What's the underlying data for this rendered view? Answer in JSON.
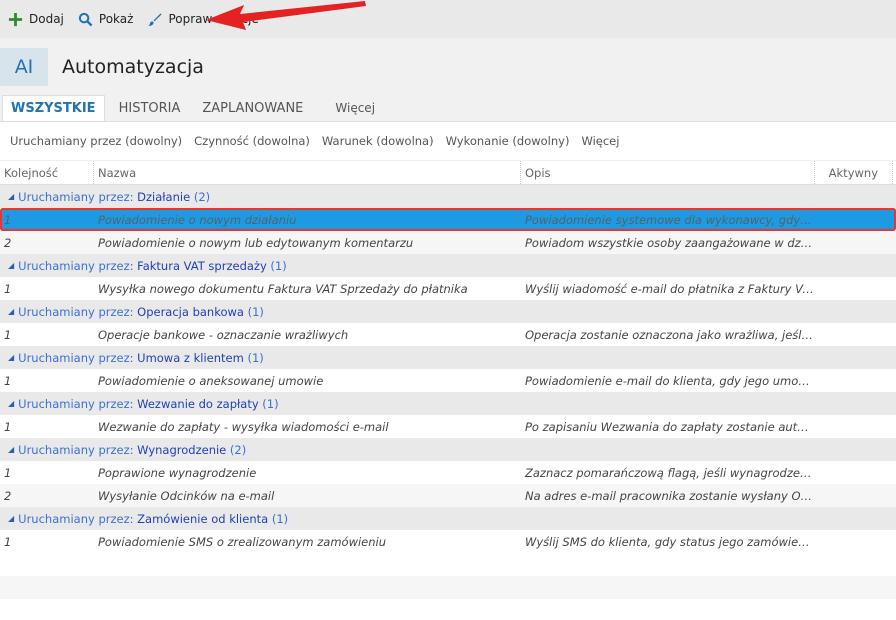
{
  "toolbar": {
    "add": "Dodaj",
    "show": "Pokaż",
    "edit": "Popraw",
    "actions": "Akcje"
  },
  "header": {
    "badge": "AI",
    "title": "Automatyzacja"
  },
  "tabs": [
    "WSZYSTKIE",
    "HISTORIA",
    "ZAPLANOWANE",
    "Więcej"
  ],
  "filters": [
    "Uruchamiany przez (dowolny)",
    "Czynność (dowolna)",
    "Warunek (dowolna)",
    "Wykonanie (dowolny)",
    "Więcej"
  ],
  "columns": {
    "order": "Kolejność",
    "name": "Nazwa",
    "desc": "Opis",
    "active": "Aktywny"
  },
  "group_prefix": "Uruchamiany przez:",
  "groups": [
    {
      "name": "Działanie",
      "count": "(2)",
      "rows": [
        {
          "order": "1",
          "name": "Powiadomienie o nowym działaniu",
          "desc": "Powiadomienie systemowe dla wykonawcy, gdy dod...",
          "selected": true
        },
        {
          "order": "2",
          "name": "Powiadomienie o nowym lub edytowanym komentarzu",
          "desc": "Powiadom wszystkie osoby zaangażowane w działan..."
        }
      ]
    },
    {
      "name": "Faktura VAT sprzedaży",
      "count": "(1)",
      "rows": [
        {
          "order": "1",
          "name": "Wysyłka nowego dokumentu Faktura VAT Sprzedaży do płatnika",
          "desc": "Wyślij wiadomość e-mail do płatnika z Faktury VAT s..."
        }
      ]
    },
    {
      "name": "Operacja bankowa",
      "count": "(1)",
      "rows": [
        {
          "order": "1",
          "name": "Operacje bankowe - oznaczanie wrażliwych",
          "desc": "Operacja zostanie oznaczona jako wrażliwa, jeśli dot..."
        }
      ]
    },
    {
      "name": "Umowa z klientem",
      "count": "(1)",
      "rows": [
        {
          "order": "1",
          "name": "Powiadomienie o aneksowanej umowie",
          "desc": "Powiadomienie e-mail do klienta, gdy jego umowa z..."
        }
      ]
    },
    {
      "name": "Wezwanie do zapłaty",
      "count": "(1)",
      "rows": [
        {
          "order": "1",
          "name": "Wezwanie do zapłaty - wysyłka wiadomości e-mail",
          "desc": "Po zapisaniu Wezwania do zapłaty zostanie automat..."
        }
      ]
    },
    {
      "name": "Wynagrodzenie",
      "count": "(2)",
      "rows": [
        {
          "order": "1",
          "name": "Poprawione wynagrodzenie",
          "desc": "Zaznacz pomarańczową flagą, jeśli wynagrodzenie z..."
        },
        {
          "order": "2",
          "name": "Wysyłanie Odcinków na e-mail",
          "desc": "Na adres e-mail pracownika zostanie wysłany Odcin..."
        }
      ]
    },
    {
      "name": "Zamówienie od klienta",
      "count": "(1)",
      "rows": [
        {
          "order": "1",
          "name": "Powiadomienie SMS o zrealizowanym zamówieniu",
          "desc": "Wyślij SMS do klienta, gdy status jego zamówienia zo..."
        }
      ]
    }
  ],
  "colors": {
    "accent": "#1e73b4",
    "selection": "#1e9be0",
    "annotation": "#e52222"
  }
}
